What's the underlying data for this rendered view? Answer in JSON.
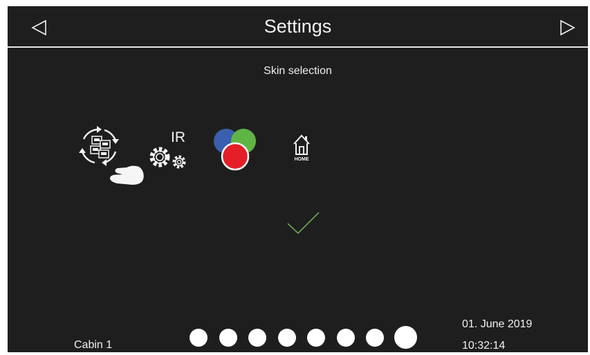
{
  "header": {
    "title": "Settings",
    "prev_icon": "triangle-left-outline-icon",
    "next_icon": "triangle-right-outline-icon"
  },
  "main": {
    "subtitle": "Skin selection",
    "skins": [
      {
        "name": "sync-touch",
        "icon": "rotating-screens-hand-icon"
      },
      {
        "name": "ir",
        "label": "IR",
        "icon": "gears-icon"
      },
      {
        "name": "color",
        "icon": "rgb-circles-icon"
      },
      {
        "name": "home",
        "label": "HOME",
        "icon": "house-icon"
      }
    ],
    "confirm_icon": "checkmark-icon"
  },
  "footer": {
    "cabin": "Cabin 1",
    "date": "01. June 2019",
    "time": "10:32:14",
    "page_count": 8,
    "active_page": 8
  },
  "colors": {
    "background": "#1e1e1e",
    "text": "#f2f2f2",
    "check": "#6aa84f",
    "blue": "#3a5fae",
    "green": "#5fb446",
    "red": "#e41e26"
  }
}
